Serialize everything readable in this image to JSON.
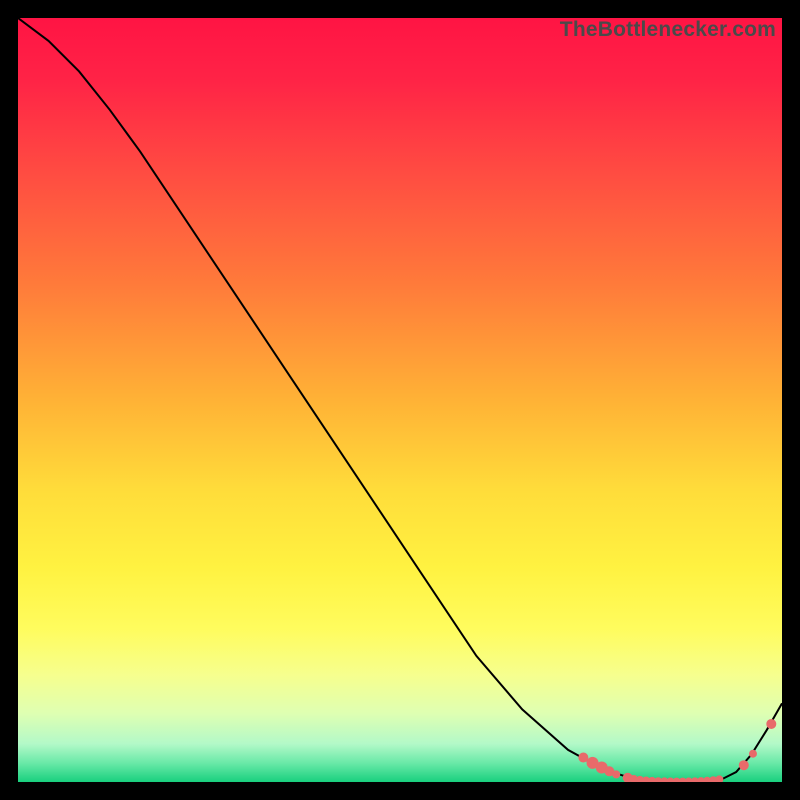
{
  "watermark": "TheBottlenecker.com",
  "chart_data": {
    "type": "line",
    "title": "",
    "xlabel": "",
    "ylabel": "",
    "xlim": [
      0,
      100
    ],
    "ylim": [
      0,
      100
    ],
    "grid": false,
    "legend": false,
    "background_gradient": [
      {
        "stop": 0.0,
        "color": "#ff1444"
      },
      {
        "stop": 0.08,
        "color": "#ff2346"
      },
      {
        "stop": 0.2,
        "color": "#ff4b42"
      },
      {
        "stop": 0.35,
        "color": "#ff7b3a"
      },
      {
        "stop": 0.5,
        "color": "#ffb236"
      },
      {
        "stop": 0.62,
        "color": "#ffdd3a"
      },
      {
        "stop": 0.72,
        "color": "#fff241"
      },
      {
        "stop": 0.8,
        "color": "#fffc5e"
      },
      {
        "stop": 0.86,
        "color": "#f6ff8e"
      },
      {
        "stop": 0.91,
        "color": "#dfffb2"
      },
      {
        "stop": 0.95,
        "color": "#b3f9c8"
      },
      {
        "stop": 0.975,
        "color": "#6ae9a8"
      },
      {
        "stop": 1.0,
        "color": "#19d07e"
      }
    ],
    "series": [
      {
        "name": "bottleneck-curve",
        "stroke": "#000000",
        "stroke_width": 2,
        "x": [
          0,
          4,
          8,
          12,
          16,
          22,
          28,
          36,
          44,
          52,
          60,
          66,
          72,
          76,
          78,
          80,
          82,
          84,
          86,
          88,
          90,
          92,
          94,
          96,
          98,
          100
        ],
        "y": [
          100,
          97,
          93,
          88,
          82.5,
          73.5,
          64.5,
          52.5,
          40.5,
          28.5,
          16.5,
          9.5,
          4.2,
          2.0,
          1.2,
          0.6,
          0.25,
          0.1,
          0.05,
          0.05,
          0.1,
          0.3,
          1.3,
          3.6,
          6.8,
          10.3
        ]
      }
    ],
    "markers": {
      "color": "#e86a6a",
      "description": "highlighted near-zero bottleneck region and rising tail",
      "points": [
        {
          "x": 74.0,
          "y": 3.2,
          "r": 5
        },
        {
          "x": 75.2,
          "y": 2.5,
          "r": 6
        },
        {
          "x": 76.4,
          "y": 1.9,
          "r": 6
        },
        {
          "x": 77.4,
          "y": 1.4,
          "r": 5
        },
        {
          "x": 78.3,
          "y": 1.0,
          "r": 4
        },
        {
          "x": 79.8,
          "y": 0.55,
          "r": 5
        },
        {
          "x": 80.6,
          "y": 0.4,
          "r": 4
        },
        {
          "x": 81.4,
          "y": 0.28,
          "r": 4
        },
        {
          "x": 82.2,
          "y": 0.2,
          "r": 4
        },
        {
          "x": 83.0,
          "y": 0.14,
          "r": 4
        },
        {
          "x": 83.8,
          "y": 0.1,
          "r": 4
        },
        {
          "x": 84.6,
          "y": 0.08,
          "r": 4
        },
        {
          "x": 85.4,
          "y": 0.06,
          "r": 4
        },
        {
          "x": 86.2,
          "y": 0.05,
          "r": 4
        },
        {
          "x": 87.0,
          "y": 0.05,
          "r": 4
        },
        {
          "x": 87.8,
          "y": 0.06,
          "r": 4
        },
        {
          "x": 88.6,
          "y": 0.08,
          "r": 4
        },
        {
          "x": 89.4,
          "y": 0.11,
          "r": 4
        },
        {
          "x": 90.2,
          "y": 0.16,
          "r": 4
        },
        {
          "x": 91.0,
          "y": 0.23,
          "r": 4
        },
        {
          "x": 91.8,
          "y": 0.34,
          "r": 4
        },
        {
          "x": 95.0,
          "y": 2.2,
          "r": 5
        },
        {
          "x": 96.2,
          "y": 3.7,
          "r": 4
        },
        {
          "x": 98.6,
          "y": 7.6,
          "r": 5
        }
      ]
    }
  }
}
